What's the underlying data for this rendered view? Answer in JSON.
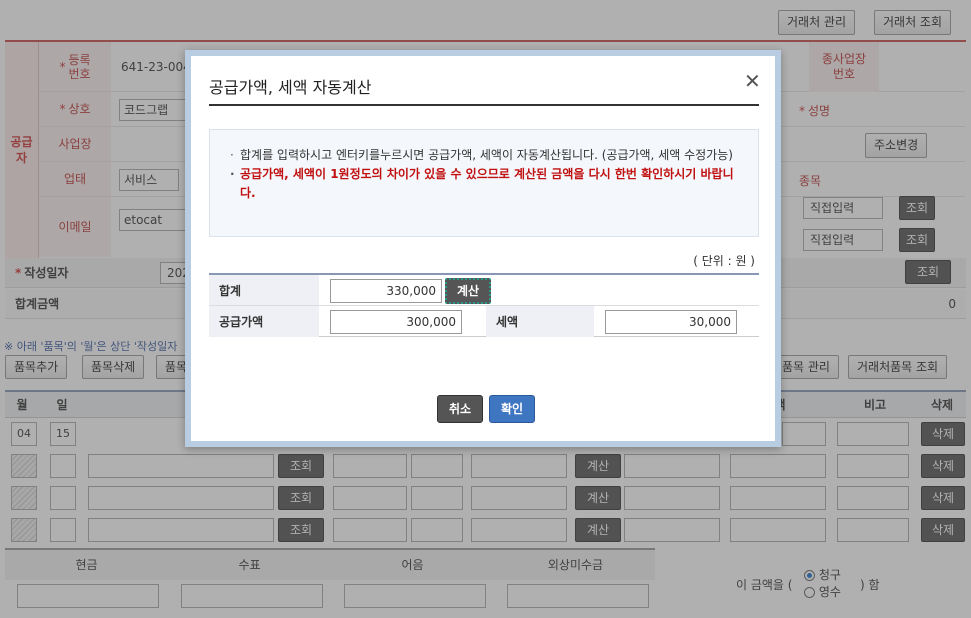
{
  "top_buttons": {
    "partner_manage": "거래처 관리",
    "partner_search": "거래처 조회"
  },
  "supplier": {
    "side_label": "공급자",
    "reg_no_label": "등록\n번호",
    "reg_no_value": "641-23-0042",
    "branch_no_label": "종사업장\n번호",
    "company_label": "상호",
    "company_value": "코드그랩",
    "name_label": "성명",
    "address_label": "사업장",
    "address_change_button": "주소변경",
    "business_type_label": "업태",
    "business_type_value": "서비스",
    "item_label": "종목",
    "email_label": "이메일",
    "email_value": "etocat",
    "direct_input_1": "직접입력",
    "direct_input_2": "직접입력",
    "search_button": "조회"
  },
  "date_row": {
    "label": "작성일자",
    "value": "202",
    "search_button": "조회"
  },
  "total_row": {
    "label": "합계금액",
    "value": "0"
  },
  "note": "※ 아래 '품목'의 '월'은 상단 '작성일자",
  "item_buttons": {
    "add": "품목추가",
    "delete": "품목삭제",
    "item": "품목",
    "item_manage": "품목 관리",
    "partner_item_search": "거래처품목 조회"
  },
  "grid_headers": {
    "month": "월",
    "day": "일",
    "tax": "액",
    "memo": "비고",
    "delete": "삭제"
  },
  "grid_row1": {
    "month": "04",
    "day": "15"
  },
  "grid_buttons": {
    "search": "조회",
    "calc": "계산",
    "delete": "삭제"
  },
  "payment_headers": [
    "현금",
    "수표",
    "어음",
    "외상미수금"
  ],
  "receipt": {
    "prefix": "이 금액을 (",
    "option_claim": "청구",
    "option_receipt": "영수",
    "suffix": ") 함",
    "selected": "청구"
  },
  "modal": {
    "title": "공급가액, 세액 자동계산",
    "close_icon": "close-icon",
    "info_line1": "합계를 입력하시고 엔터키를누르시면 공급가액, 세액이 자동계산됩니다. (공급가액, 세액 수정가능)",
    "info_line2": "공급가액, 세액이 1원정도의 차이가 있을 수 있으므로 계산된 금액을 다시 한번 확인하시기 바랍니다.",
    "unit": "( 단위 : 원 )",
    "total_label": "합계",
    "total_value": "330,000",
    "calc_button": "계산",
    "supply_label": "공급가액",
    "supply_value": "300,000",
    "tax_label": "세액",
    "tax_value": "30,000",
    "cancel_button": "취소",
    "ok_button": "확인"
  },
  "colors": {
    "accent_red": "#c33333",
    "modal_border": "#b9cde2",
    "ok_button": "#3e76c1",
    "warn_text": "#c01010"
  }
}
